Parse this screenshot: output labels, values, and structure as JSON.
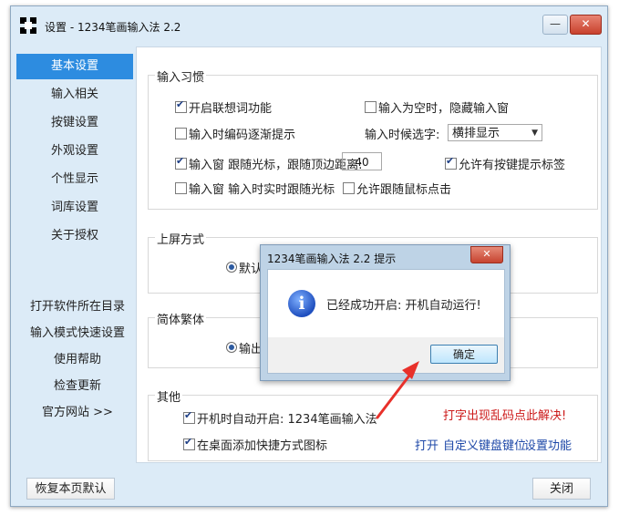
{
  "window": {
    "title": "设置 - 1234笔画输入法 2.2",
    "minimize_glyph": "—",
    "close_glyph": "✕"
  },
  "sidebar": {
    "items": [
      {
        "label": "基本设置",
        "active": true
      },
      {
        "label": "输入相关"
      },
      {
        "label": "按键设置"
      },
      {
        "label": "外观设置"
      },
      {
        "label": "个性显示"
      },
      {
        "label": "词库设置"
      },
      {
        "label": "关于授权"
      }
    ],
    "links": [
      {
        "label": "打开软件所在目录"
      },
      {
        "label": "输入模式快速设置"
      },
      {
        "label": "使用帮助"
      },
      {
        "label": "检查更新"
      },
      {
        "label": "官方网站 >>"
      }
    ]
  },
  "groups": {
    "input_habits": {
      "title": "输入习惯",
      "options": [
        {
          "label": "开启联想词功能",
          "checked": true
        },
        {
          "label": "输入为空时，隐藏输入窗",
          "checked": false
        },
        {
          "label": "输入时编码逐渐提示",
          "checked": false
        },
        {
          "label": "输入窗 跟随光标，跟随顶边距离:",
          "checked": true
        },
        {
          "label": "允许有按键提示标签",
          "checked": true
        },
        {
          "label": "输入窗 输入时实时跟随光标",
          "checked": false
        },
        {
          "label": "允许跟随鼠标点击",
          "checked": false
        }
      ],
      "select_label": "输入时候选字:",
      "select_value": "横排显示",
      "distance_value": "40"
    },
    "commit": {
      "title": "上屏方式",
      "radio_label": "默认接"
    },
    "charset": {
      "title": "简体繁体",
      "radio_label": "输出为"
    },
    "other": {
      "title": "其他",
      "options": [
        {
          "label": "开机时自动开启: 1234笔画输入法",
          "checked": true
        },
        {
          "label": "在桌面添加快捷方式图标",
          "checked": true
        }
      ],
      "red_notice": "打字出现乱码点此解决!",
      "links": [
        "打开",
        "自定义键盘键位",
        "设置功能"
      ]
    }
  },
  "footer": {
    "restore_label": "恢复本页默认",
    "close_label": "关闭"
  },
  "dialog": {
    "title": "1234笔画输入法 2.2 提示",
    "message": "已经成功开启: 开机自动运行!",
    "ok_label": "确定",
    "icon_glyph": "i"
  },
  "colors": {
    "accent": "#2d8ce0",
    "notice": "#cc1a1a",
    "link": "#1e48a8",
    "arrow": "#e8302a"
  }
}
